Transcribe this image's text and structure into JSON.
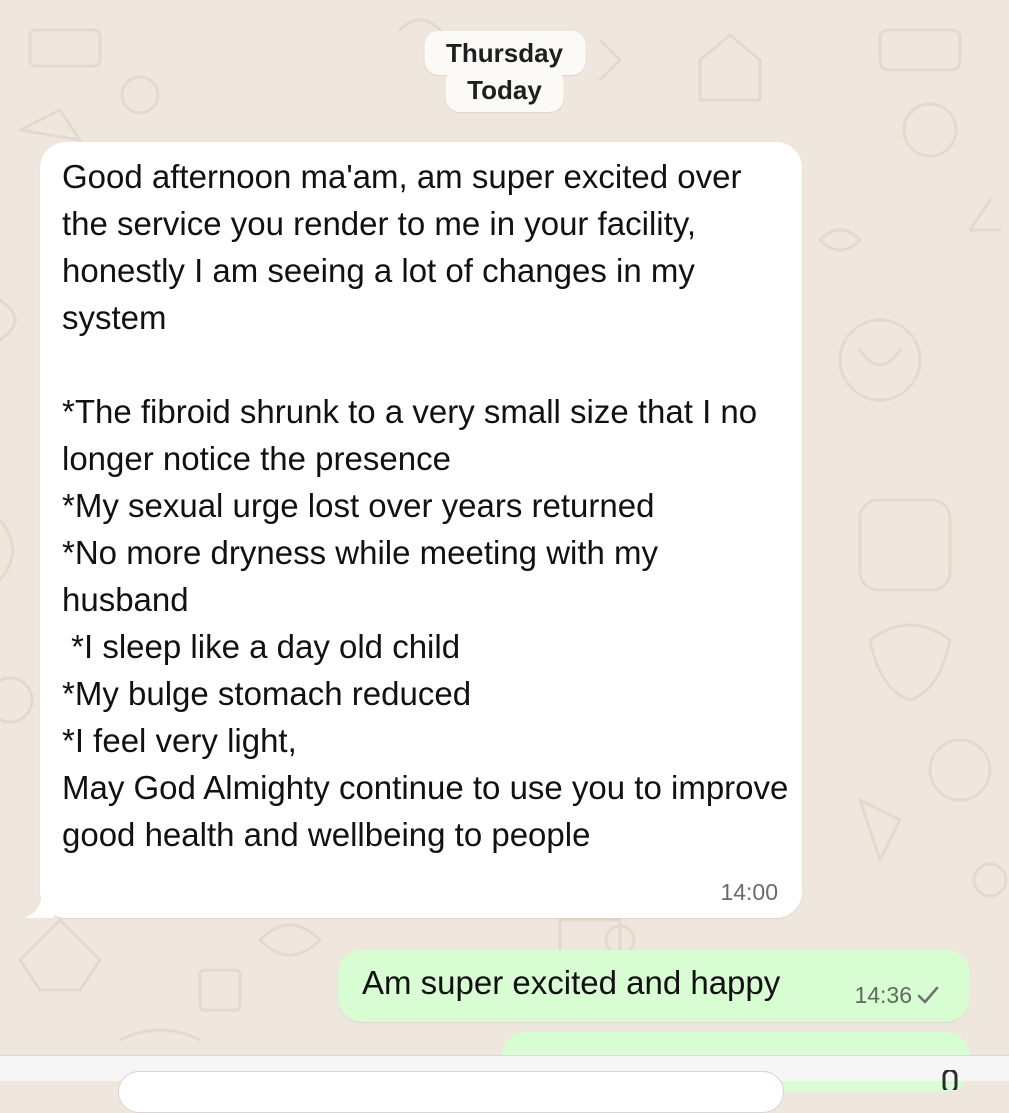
{
  "date_pills": [
    "Thursday",
    "Today"
  ],
  "incoming_message": {
    "text": "Good afternoon ma'am, am super excited over the service you render to me in your facility, honestly I am seeing a lot of changes in my system\n\n*The fibroid shrunk to a very small size that I no longer notice the presence\n*My sexual urge lost over years returned\n*No more dryness while meeting with my husband\n *I sleep like a day old child\n*My bulge stomach reduced\n*I feel very light,\nMay God Almighty continue to use you to improve good health and wellbeing to people",
    "time": "14:00"
  },
  "outgoing_message": {
    "text": "Am super excited and happy",
    "time": "14:36",
    "status_icon": "single-check-icon"
  },
  "colors": {
    "wallpaper": "#efe7dd",
    "incoming_bubble": "#ffffff",
    "outgoing_bubble": "#d9fdd3",
    "date_pill": "#fbfaf7"
  }
}
